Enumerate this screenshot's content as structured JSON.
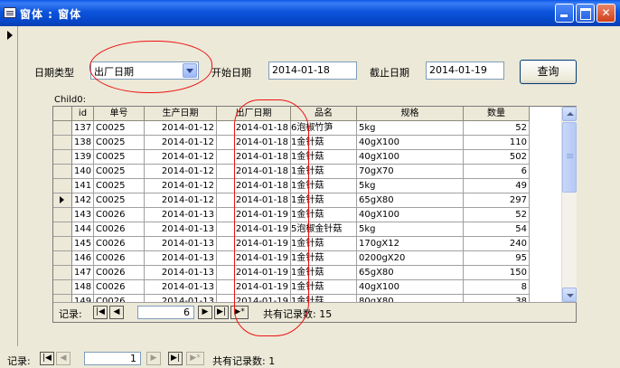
{
  "window": {
    "title": "窗体 : 窗体"
  },
  "filters": {
    "date_type_label": "日期类型",
    "date_type_value": "出厂日期",
    "start_label": "开始日期",
    "start_value": "2014-01-18",
    "end_label": "截止日期",
    "end_value": "2014-01-19",
    "query_button": "查询"
  },
  "subform": {
    "name": "Child0:",
    "columns": [
      "id",
      "单号",
      "生产日期",
      "出厂日期",
      "品名",
      "规格",
      "数量"
    ],
    "rows": [
      [
        "137",
        "C0025",
        "2014-01-12",
        "2014-01-18",
        "泡椒竹笋",
        "5kg",
        "52"
      ],
      [
        "138",
        "C0025",
        "2014-01-12",
        "2014-01-18",
        "金针菇",
        "40gX100",
        "110"
      ],
      [
        "139",
        "C0025",
        "2014-01-12",
        "2014-01-18",
        "金针菇",
        "40gX100",
        "502"
      ],
      [
        "140",
        "C0025",
        "2014-01-12",
        "2014-01-18",
        "金针菇",
        "70gX70",
        "6"
      ],
      [
        "141",
        "C0025",
        "2014-01-12",
        "2014-01-18",
        "金针菇",
        "5kg",
        "49"
      ],
      [
        "142",
        "C0025",
        "2014-01-12",
        "2014-01-18",
        "金针菇",
        "65gX80",
        "297"
      ],
      [
        "143",
        "C0026",
        "2014-01-13",
        "2014-01-19",
        "金针菇",
        "40gX100",
        "52"
      ],
      [
        "144",
        "C0026",
        "2014-01-13",
        "2014-01-19",
        "泡椒金针菇",
        "5kg",
        "54"
      ],
      [
        "145",
        "C0026",
        "2014-01-13",
        "2014-01-19",
        "金针菇",
        "170gX12",
        "240"
      ],
      [
        "146",
        "C0026",
        "2014-01-13",
        "2014-01-19",
        "金针菇",
        "0200gX20",
        "95"
      ],
      [
        "147",
        "C0026",
        "2014-01-13",
        "2014-01-19",
        "金针菇",
        "65gX80",
        "150"
      ],
      [
        "148",
        "C0026",
        "2014-01-13",
        "2014-01-19",
        "金针菇",
        "40gX100",
        "8"
      ],
      [
        "149",
        "C0026",
        "2014-01-13",
        "2014-01-19",
        "金针菇",
        "80gX80",
        "38"
      ]
    ],
    "row_code_prefix": [
      "6",
      "1",
      "1",
      "1",
      "1",
      "1",
      "1",
      "5",
      "1",
      "1",
      "1",
      "1",
      "1"
    ],
    "nav": {
      "label": "记录:",
      "current": "6",
      "total_text": "共有记录数: 15"
    }
  },
  "outer_nav": {
    "label": "记录:",
    "current": "1",
    "total_text": "共有记录数: 1"
  }
}
